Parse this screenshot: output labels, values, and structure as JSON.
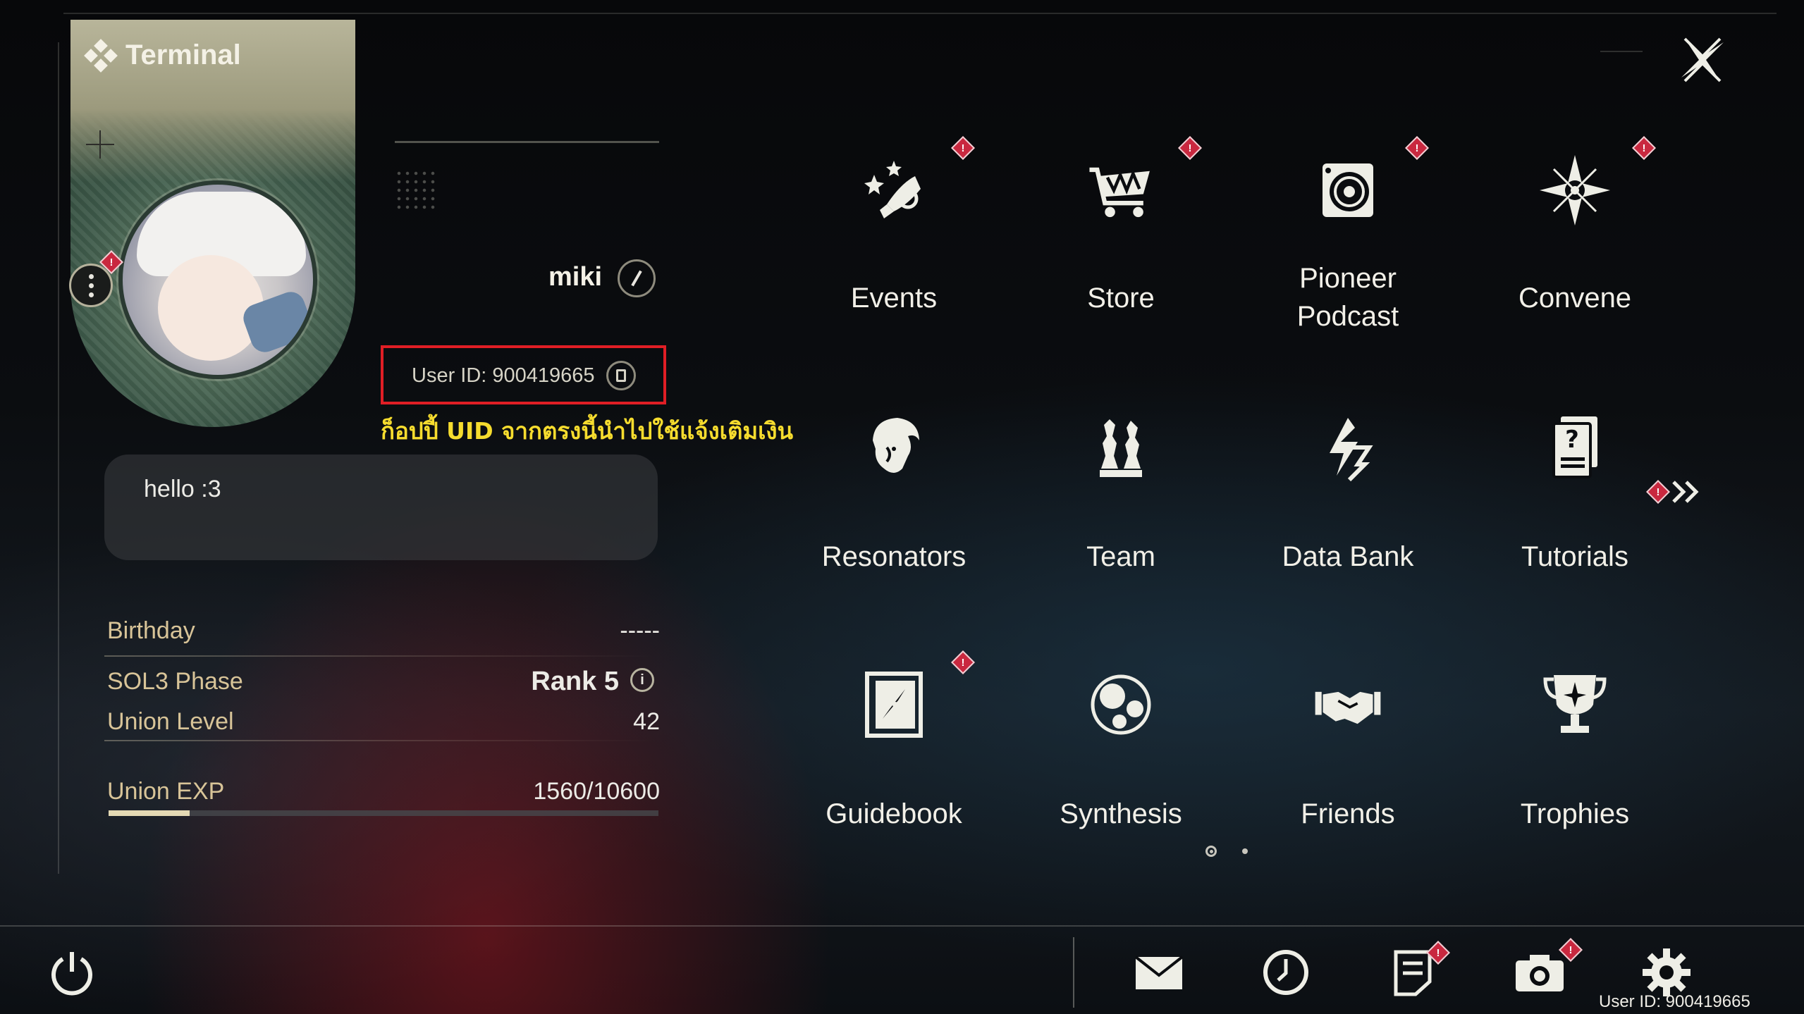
{
  "panel": {
    "title": "Terminal",
    "username": "miki",
    "user_id": "User ID: 900419665",
    "uid_note": "ก็อปปี้ UID จากตรงนี้นำไปใช้แจ้งเติมเงิน",
    "bio": "hello :3"
  },
  "profile_info": [
    {
      "label": "Birthday",
      "value": "-----"
    },
    {
      "label": "SOL3 Phase",
      "value": "Rank 5",
      "info_icon": "i"
    },
    {
      "label": "Union Level",
      "value": "42"
    },
    {
      "label": "Union EXP",
      "value": "1560/10600",
      "progress_fraction": 0.147
    }
  ],
  "menu": [
    {
      "label": "Events",
      "icon": "events-icon",
      "alert": true
    },
    {
      "label": "Store",
      "icon": "cart-icon",
      "alert": true
    },
    {
      "label": "Pioneer\nPodcast",
      "label_line1": "Pioneer",
      "label_line2": "Podcast",
      "icon": "podcast-icon",
      "alert": true
    },
    {
      "label": "Convene",
      "icon": "convene-icon",
      "alert": true
    },
    {
      "label": "Resonators",
      "icon": "resonator-icon",
      "alert": false
    },
    {
      "label": "Team",
      "icon": "team-icon",
      "alert": false
    },
    {
      "label": "Data Bank",
      "icon": "data-bank-icon",
      "alert": false
    },
    {
      "label": "Tutorials",
      "icon": "tutorial-icon",
      "alert": false
    },
    {
      "label": "Guidebook",
      "icon": "guidebook-icon",
      "alert": true
    },
    {
      "label": "Synthesis",
      "icon": "synthesis-icon",
      "alert": false
    },
    {
      "label": "Friends",
      "icon": "handshake-icon",
      "alert": false
    },
    {
      "label": "Trophies",
      "icon": "trophy-icon",
      "alert": false
    }
  ],
  "pagination": {
    "pages": 2,
    "current": 1
  },
  "bottom_bar": {
    "icons": [
      "power-icon",
      "mail-icon",
      "clock-icon",
      "notes-icon",
      "camera-icon",
      "settings-icon"
    ],
    "footer_uid": "User ID: 900419665"
  },
  "colors": {
    "alert": "#c9283f",
    "highlight_box": "#e01e25",
    "note_text": "#f6dc2e",
    "label_gold": "#d8c498",
    "text": "#f2f0e8"
  }
}
